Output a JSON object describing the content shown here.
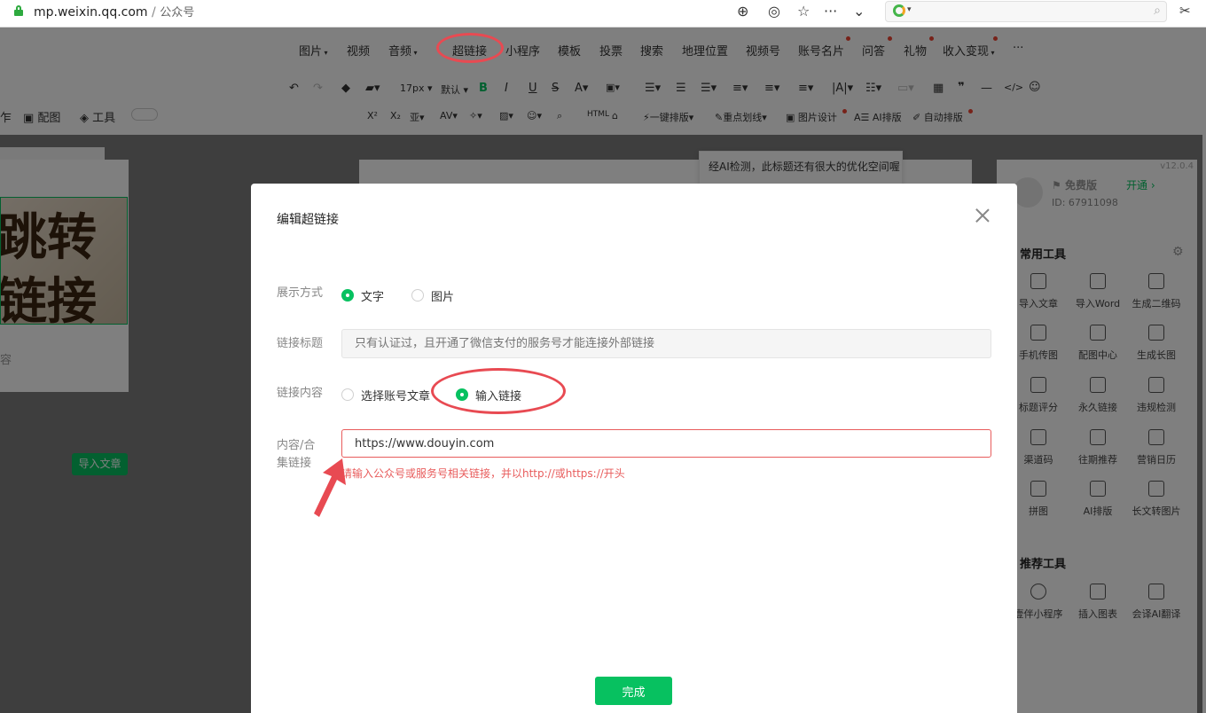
{
  "browser": {
    "host": "mp.weixin.qq.com",
    "separator": "/",
    "path": "公众号"
  },
  "editor": {
    "menu": [
      "图片",
      "视频",
      "音频",
      "超链接",
      "小程序",
      "模板",
      "投票",
      "搜索",
      "地理位置",
      "视频号",
      "账号名片",
      "问答",
      "礼物",
      "收入变现",
      "···"
    ],
    "font_size": "17px",
    "font_default": "默认",
    "toolbar2": [
      "一键排版",
      "重点划线",
      "图片设计",
      "AI排版",
      "自动排版"
    ],
    "left_tools": [
      "配图",
      "工具"
    ],
    "cover_text": [
      "跳转",
      "链接"
    ],
    "left_desc": "容",
    "import_article": "导入文章",
    "ai_tip": "经AI检测，此标题还有很大的优化空间喔"
  },
  "right_panel": {
    "version": "v12.0.4",
    "plan": "免费版",
    "open": "开通",
    "id_label": "ID: 67911098",
    "common_title": "常用工具",
    "common_tools": [
      "导入文章",
      "导入Word",
      "生成二维码",
      "手机传图",
      "配图中心",
      "生成长图",
      "标题评分",
      "永久链接",
      "违规检测",
      "渠道码",
      "往期推荐",
      "营销日历",
      "拼图",
      "AI排版",
      "长文转图片"
    ],
    "recommend_title": "推荐工具",
    "recommend_tools": [
      "壹伴小程序",
      "插入图表",
      "会译AI翻译"
    ]
  },
  "dialog": {
    "title": "编辑超链接",
    "display_label": "展示方式",
    "display_options": [
      "文字",
      "图片"
    ],
    "display_selected": "文字",
    "link_title_label": "链接标题",
    "link_title_placeholder": "只有认证过，且开通了微信支付的服务号才能连接外部链接",
    "content_label": "链接内容",
    "content_options": [
      "选择账号文章",
      "输入链接"
    ],
    "content_selected": "输入链接",
    "url_label_line1": "内容/合",
    "url_label_line2": "集链接",
    "url_value": "https://www.douyin.com",
    "error": "请输入公众号或服务号相关链接，并以http://或https://开头",
    "done": "完成"
  },
  "colors": {
    "accent": "#07c160",
    "error": "#e85c5c",
    "annotation": "#e84a52"
  }
}
